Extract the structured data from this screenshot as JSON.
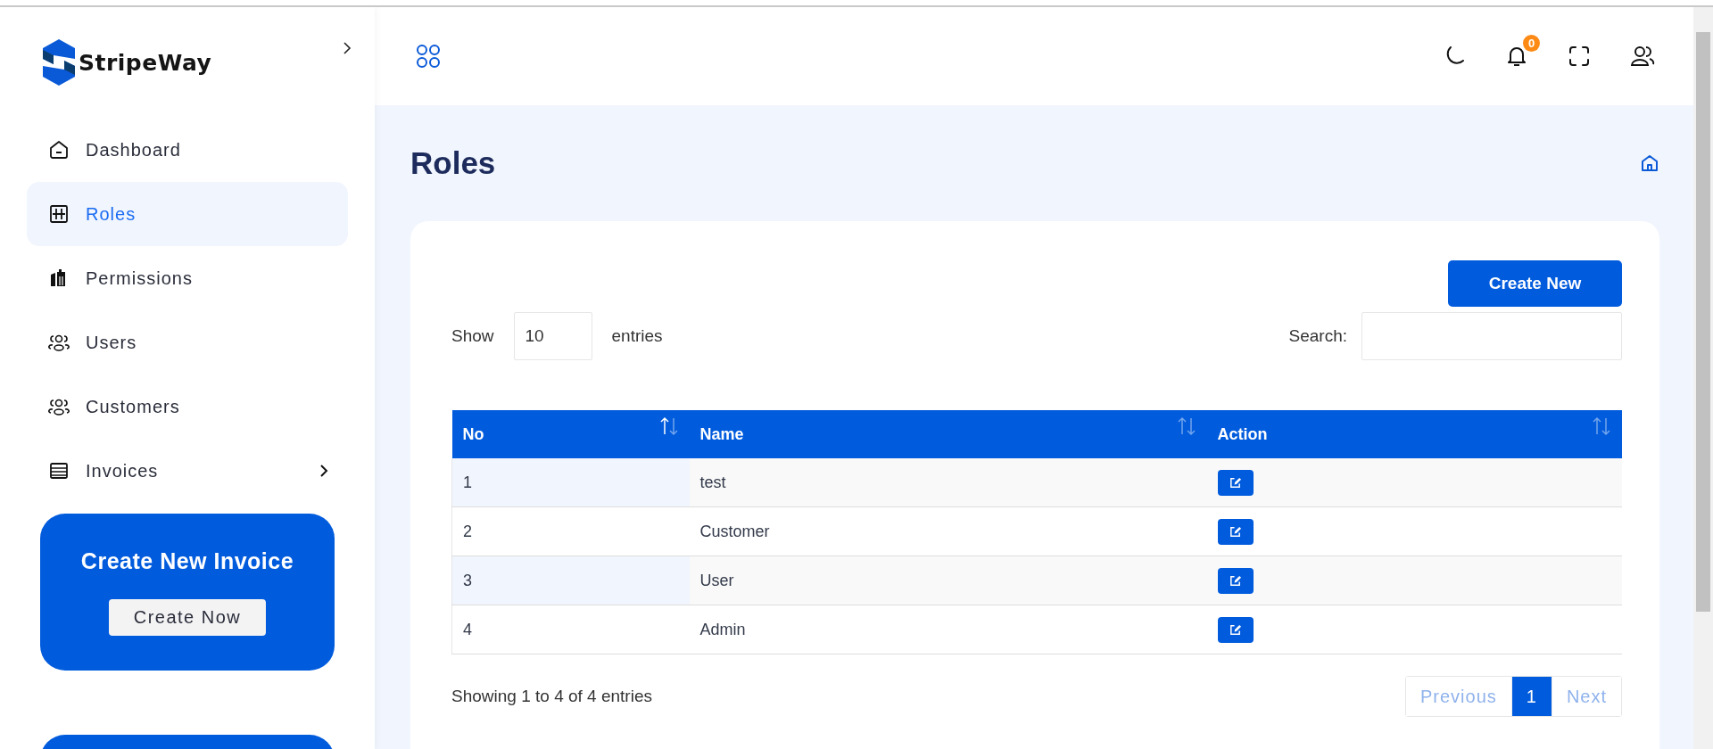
{
  "brand": {
    "name": "StripeWay"
  },
  "sidebar": {
    "items": [
      {
        "label": "Dashboard",
        "selected": false,
        "has_submenu": false
      },
      {
        "label": "Roles",
        "selected": true,
        "has_submenu": false
      },
      {
        "label": "Permissions",
        "selected": false,
        "has_submenu": false
      },
      {
        "label": "Users",
        "selected": false,
        "has_submenu": false
      },
      {
        "label": "Customers",
        "selected": false,
        "has_submenu": false
      },
      {
        "label": "Invoices",
        "selected": false,
        "has_submenu": true
      }
    ],
    "promo": {
      "title": "Create New Invoice",
      "button": "Create Now"
    }
  },
  "header": {
    "notifications": {
      "count": "0"
    }
  },
  "page": {
    "title": "Roles"
  },
  "card": {
    "create_button": "Create New",
    "length": {
      "before": "Show",
      "value": "10",
      "after": "entries"
    },
    "search": {
      "label": "Search:"
    },
    "table": {
      "columns": [
        {
          "label": "No",
          "sorted": true
        },
        {
          "label": "Name",
          "sorted": false
        },
        {
          "label": "Action",
          "sorted": false
        }
      ],
      "rows": [
        {
          "no": "1",
          "name": "test"
        },
        {
          "no": "2",
          "name": "Customer"
        },
        {
          "no": "3",
          "name": "User"
        },
        {
          "no": "4",
          "name": "Admin"
        }
      ]
    },
    "info": "Showing 1 to 4 of 4 entries",
    "pagination": [
      {
        "label": "Previous",
        "selected": false,
        "disabled": true
      },
      {
        "label": "1",
        "selected": true,
        "disabled": false
      },
      {
        "label": "Next",
        "selected": false,
        "disabled": true
      }
    ]
  }
}
